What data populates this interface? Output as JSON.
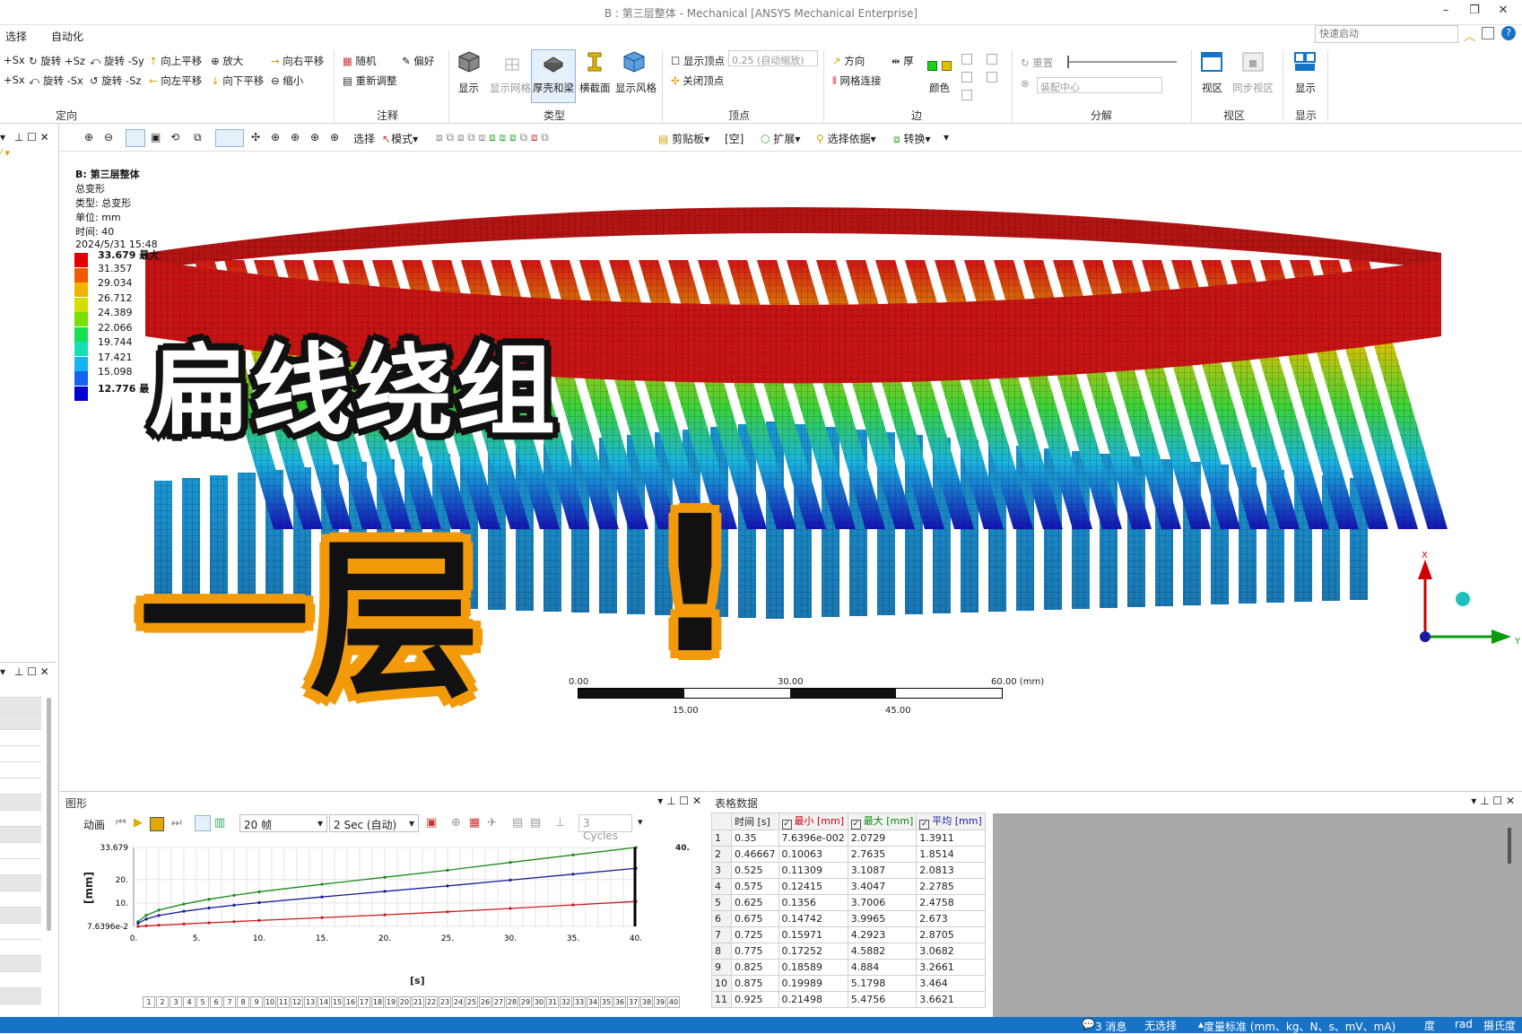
{
  "window": {
    "title": "B : 第三层整体 - Mechanical [ANSYS Mechanical Enterprise]"
  },
  "menu": {
    "select": "选择",
    "automation": "自动化",
    "quick_launch_placeholder": "快速启动"
  },
  "ribbon": {
    "orient": {
      "label": "定向",
      "items": [
        "+Sx",
        "旋转 +Sz",
        "旋转 -Sy",
        "向上平移",
        "放大",
        "向右平移",
        "+Sx",
        "旋转 -Sx",
        "旋转 -Sz",
        "向左平移",
        "向下平移",
        "缩小"
      ]
    },
    "annotate": {
      "label": "注释",
      "random": "随机",
      "prefs": "偏好",
      "reset": "重新调整"
    },
    "type": {
      "label": "类型",
      "display": "显示",
      "show_mesh": "显示网格",
      "thick_shell": "厚壳和梁",
      "cross_section": "横截面",
      "show_style": "显示风格"
    },
    "vertex": {
      "label": "顶点",
      "show_vertex": "显示顶点",
      "scale_value": "0.25 (自动缩放)",
      "close_vertex": "关闭顶点"
    },
    "edge": {
      "label": "边",
      "direction": "方向",
      "thick": "厚",
      "mesh_conn": "网格连接",
      "color": "颜色"
    },
    "explode": {
      "label": "分解",
      "reset": "重置",
      "center": "装配中心"
    },
    "viewport": {
      "label": "视区",
      "view": "视区",
      "sync": "同步视区"
    },
    "display": {
      "label": "显示",
      "show": "显示"
    }
  },
  "toolbar": {
    "select": "选择",
    "mode": "模式",
    "clipboard": "剪贴板",
    "empty": "[空]",
    "extend": "扩展",
    "select_by": "选择依据",
    "convert": "转换"
  },
  "viewport_info": {
    "name": "B: 第三层整体",
    "result": "总变形",
    "type": "类型: 总变形",
    "unit": "单位: mm",
    "time": "时间: 40",
    "date": "2024/5/31 15:48"
  },
  "legend": {
    "labels": [
      "33.679 最大",
      "31.357",
      "29.034",
      "26.712",
      "24.389",
      "22.066",
      "19.744",
      "17.421",
      "15.098",
      "12.776 最"
    ],
    "colors": [
      "#e00000",
      "#f05a00",
      "#f0b400",
      "#d2e000",
      "#78e000",
      "#14e050",
      "#14e0b4",
      "#14b4f0",
      "#1464f0",
      "#0000d2"
    ]
  },
  "overlay": {
    "line1": "扁线绕组",
    "line2": "一层",
    "excl": "!"
  },
  "scalebar": {
    "t0": "0.00",
    "t30": "30.00",
    "t60": "60.00 (mm)",
    "t15": "15.00",
    "t45": "45.00"
  },
  "triad": {
    "x": "X",
    "y": "Y"
  },
  "graph_panel": {
    "title": "图形",
    "animate": "动画",
    "frames": "20 帧",
    "duration": "2 Sec (自动)",
    "cycles": "3 Cycles",
    "top_marker": "40.",
    "ylabel": "[mm]",
    "xlabel": "[s]"
  },
  "chart_data": {
    "type": "line",
    "xlabel": "[s]",
    "ylabel": "[mm]",
    "xlim": [
      0,
      40
    ],
    "ylim": [
      0.076396,
      33.679
    ],
    "ytick_labels": [
      "33.679",
      "20.",
      "10.",
      "7.6396e-2"
    ],
    "yticks": [
      33.679,
      20,
      10,
      0.076396
    ],
    "xtick_labels": [
      "0.",
      "5.",
      "10.",
      "15.",
      "20.",
      "25.",
      "30.",
      "35.",
      "40."
    ],
    "xticks": [
      0,
      5,
      10,
      15,
      20,
      25,
      30,
      35,
      40
    ],
    "x": [
      0.35,
      1,
      2,
      4,
      6,
      8,
      10,
      15,
      20,
      25,
      30,
      35,
      40
    ],
    "series": [
      {
        "name": "最大",
        "color": "#1a8a1a",
        "values": [
          2.07,
          4.8,
          7.0,
          9.6,
          11.6,
          13.3,
          14.8,
          18.0,
          21.0,
          24.0,
          27.3,
          30.5,
          33.679
        ]
      },
      {
        "name": "平均",
        "color": "#1a1a99",
        "values": [
          1.39,
          3.2,
          4.7,
          6.5,
          7.9,
          9.1,
          10.2,
          12.6,
          15.0,
          17.3,
          19.8,
          22.3,
          24.8
        ]
      },
      {
        "name": "最小",
        "color": "#cc1a1a",
        "values": [
          0.076,
          0.3,
          0.6,
          1.1,
          1.6,
          2.1,
          2.6,
          3.8,
          5.0,
          6.3,
          7.7,
          9.2,
          10.7
        ]
      }
    ]
  },
  "frame_numbers": [
    "1",
    "2",
    "3",
    "4",
    "5",
    "6",
    "7",
    "8",
    "9",
    "10",
    "11",
    "12",
    "13",
    "14",
    "15",
    "16",
    "17",
    "18",
    "19",
    "20",
    "21",
    "22",
    "23",
    "24",
    "25",
    "26",
    "27",
    "28",
    "29",
    "30",
    "31",
    "32",
    "33",
    "34",
    "35",
    "36",
    "37",
    "38",
    "39",
    "40"
  ],
  "table_panel": {
    "title": "表格数据",
    "headers": [
      "时间 [s]",
      "最小 [mm]",
      "最大 [mm]",
      "平均 [mm]"
    ],
    "rows": [
      [
        "1",
        "0.35",
        "7.6396e-002",
        "2.0729",
        "1.3911"
      ],
      [
        "2",
        "0.46667",
        "0.10063",
        "2.7635",
        "1.8514"
      ],
      [
        "3",
        "0.525",
        "0.11309",
        "3.1087",
        "2.0813"
      ],
      [
        "4",
        "0.575",
        "0.12415",
        "3.4047",
        "2.2785"
      ],
      [
        "5",
        "0.625",
        "0.1356",
        "3.7006",
        "2.4758"
      ],
      [
        "6",
        "0.675",
        "0.14742",
        "3.9965",
        "2.673"
      ],
      [
        "7",
        "0.725",
        "0.15971",
        "4.2923",
        "2.8705"
      ],
      [
        "8",
        "0.775",
        "0.17252",
        "4.5882",
        "3.0682"
      ],
      [
        "9",
        "0.825",
        "0.18589",
        "4.884",
        "3.2661"
      ],
      [
        "10",
        "0.875",
        "0.19989",
        "5.1798",
        "3.464"
      ],
      [
        "11",
        "0.925",
        "0.21498",
        "5.4756",
        "3.6621"
      ]
    ]
  },
  "status": {
    "messages": "3 消息",
    "selection": "无选择",
    "units": "度量标准 (mm、kg、N、s、mV、mA)",
    "degree": "度",
    "rad": "rad",
    "celsius": "摄氏度"
  }
}
